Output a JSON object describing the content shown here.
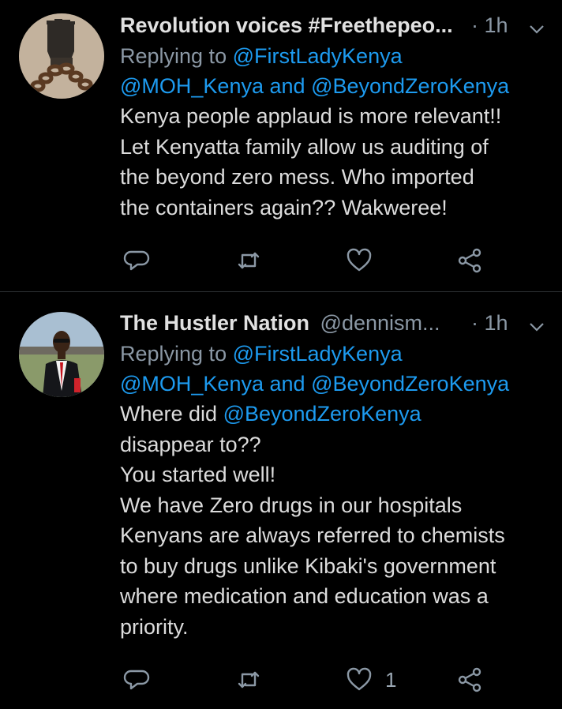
{
  "tweets": [
    {
      "display_name": "Revolution voices #Freethepeo...",
      "handle": "",
      "time": "· 1h",
      "replying_label": "Replying to",
      "replying_to_1": "@FirstLadyKenya",
      "replying_to_2": "@MOH_Kenya",
      "replying_and": "and",
      "replying_to_3": "@BeyondZeroKenya",
      "body_lines": [
        "Kenya people applaud is more relevant!!",
        "Let Kenyatta family allow us auditing of",
        "the beyond zero mess. Who imported",
        "the containers again?? Wakweree!"
      ],
      "like_count": ""
    },
    {
      "display_name": "The Hustler Nation",
      "handle": "@dennism...",
      "time": "· 1h",
      "replying_label": "Replying to",
      "replying_to_1": "@FirstLadyKenya",
      "replying_to_2": "@MOH_Kenya",
      "replying_and": "and",
      "replying_to_3": "@BeyondZeroKenya",
      "body_first_prefix": "Where did ",
      "body_first_mention": "@BeyondZeroKenya",
      "body_lines": [
        "disappear to??",
        "You started well!",
        "We have Zero drugs in our hospitals",
        "Kenyans are always referred to chemists",
        "to buy drugs unlike Kibaki's government",
        "where medication and education was a",
        "priority."
      ],
      "like_count": "1"
    }
  ],
  "icons": {
    "reply": "reply-icon",
    "retweet": "retweet-icon",
    "like": "heart-icon",
    "share": "share-icon",
    "caret": "chevron-down-icon"
  },
  "colors": {
    "background": "#000000",
    "link": "#1d9bf0",
    "muted": "#8b98a5",
    "text": "#dcdcdc"
  }
}
